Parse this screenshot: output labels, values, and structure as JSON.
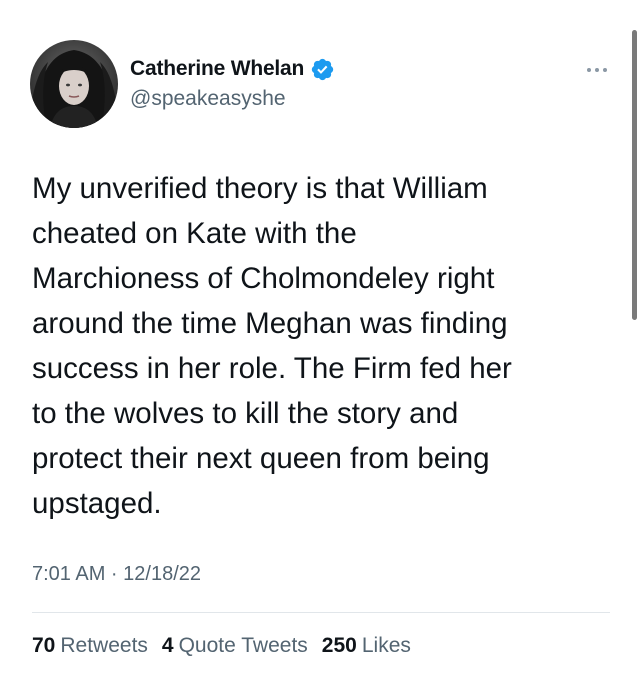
{
  "author": {
    "display_name": "Catherine Whelan",
    "handle": "@speakeasyshe",
    "verified": true,
    "avatar_icon": "profile-photo"
  },
  "tweet": {
    "text": "My unverified theory is that William\ncheated on Kate with the\nMarchioness of Cholmondeley right\naround the time Meghan was finding\nsuccess in her role. The Firm fed her\nto the wolves to kill the story and\nprotect their next queen from being\nupstaged.",
    "timestamp": "7:01 AM · 12/18/22"
  },
  "stats": {
    "retweets_count": "70",
    "retweets_label": "Retweets",
    "quotes_count": "4",
    "quotes_label": "Quote Tweets",
    "likes_count": "250",
    "likes_label": "Likes"
  },
  "icons": {
    "verified": "verified-badge-icon",
    "more": "more-options-icon"
  },
  "colors": {
    "text_primary": "#0f1419",
    "text_secondary": "#536471",
    "verified_blue": "#1d9bf0",
    "divider": "#e1e6ea"
  }
}
